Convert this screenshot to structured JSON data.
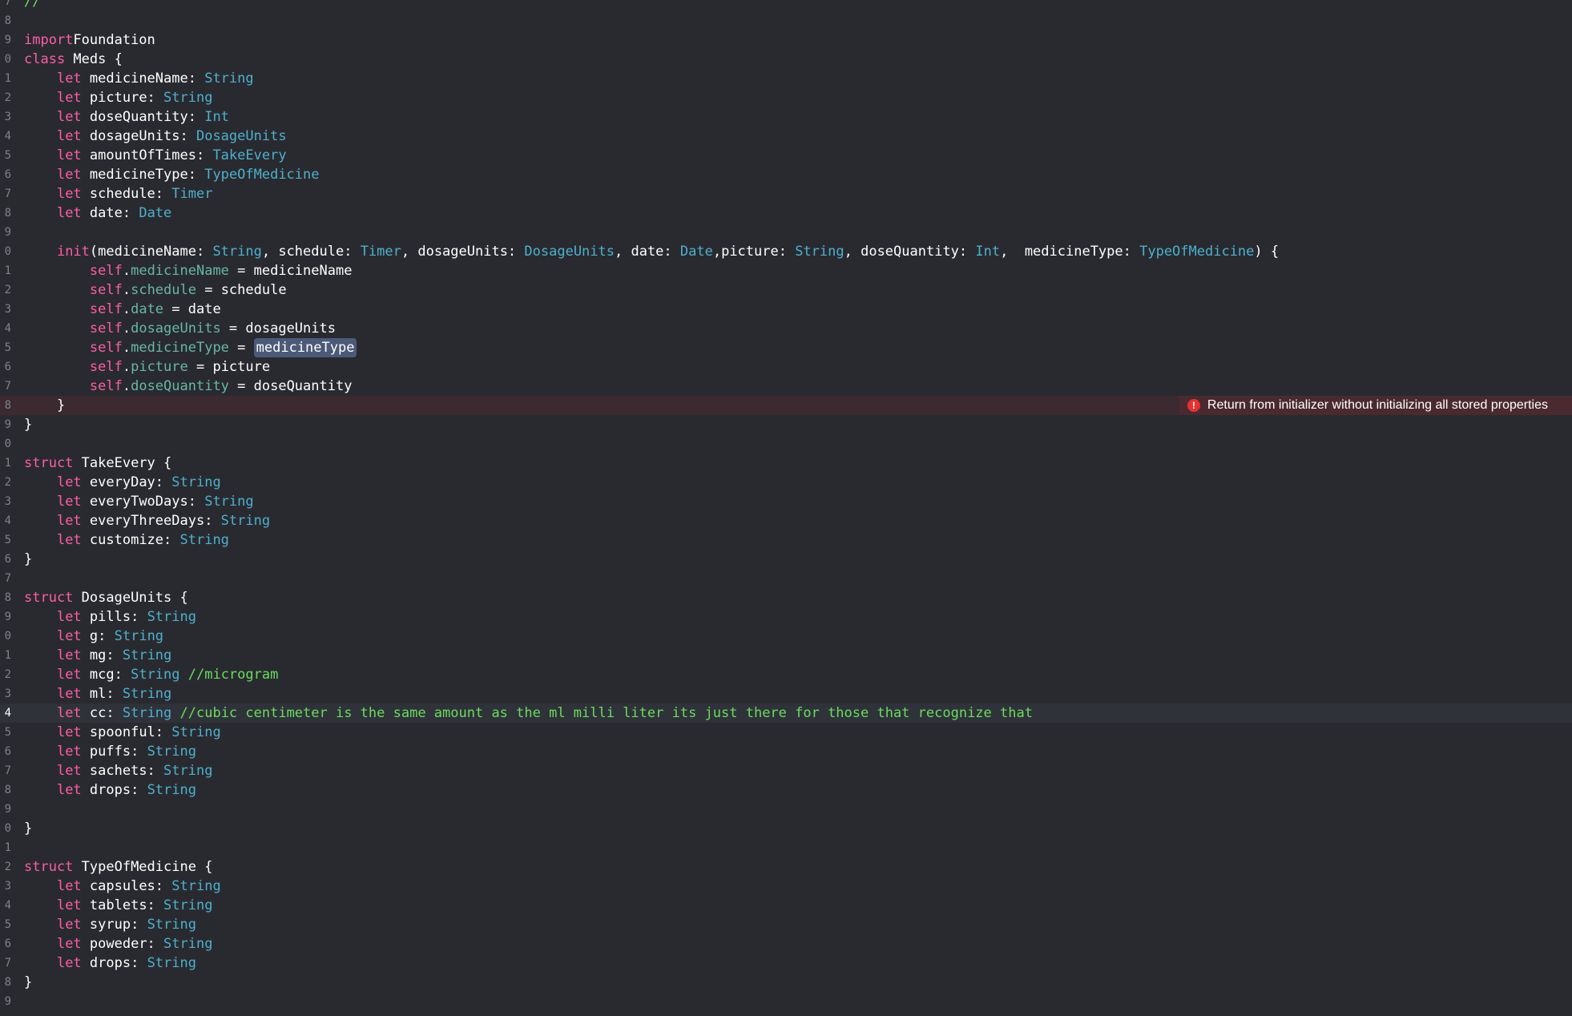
{
  "gutter": [
    "7",
    "8",
    "9",
    "0",
    "1",
    "2",
    "3",
    "4",
    "5",
    "6",
    "7",
    "8",
    "9",
    "0",
    "1",
    "2",
    "3",
    "4",
    "5",
    "6",
    "7",
    "8",
    "9",
    "0",
    "1",
    "2",
    "3",
    "4",
    "5",
    "6",
    "7",
    "8",
    "9",
    "0",
    "1",
    "2",
    "3",
    "4",
    "5",
    "6",
    "7",
    "8",
    "9",
    "0",
    "1",
    "2",
    "3",
    "4",
    "5",
    "6",
    "7",
    "8",
    "9"
  ],
  "lines": [
    [
      [
        "cmt2",
        "//"
      ]
    ],
    [],
    [
      [
        "kw",
        "import"
      ],
      [
        "",
        "Foundation"
      ]
    ],
    [
      [
        "kw",
        "class"
      ],
      [
        "",
        " Meds {"
      ]
    ],
    [
      [
        "",
        "    "
      ],
      [
        "kw",
        "let"
      ],
      [
        "",
        " medicineName: "
      ],
      [
        "typ2",
        "String"
      ]
    ],
    [
      [
        "",
        "    "
      ],
      [
        "kw",
        "let"
      ],
      [
        "",
        " picture: "
      ],
      [
        "typ2",
        "String"
      ]
    ],
    [
      [
        "",
        "    "
      ],
      [
        "kw",
        "let"
      ],
      [
        "",
        " doseQuantity: "
      ],
      [
        "typ2",
        "Int"
      ]
    ],
    [
      [
        "",
        "    "
      ],
      [
        "kw",
        "let"
      ],
      [
        "",
        " dosageUnits: "
      ],
      [
        "typ2",
        "DosageUnits"
      ]
    ],
    [
      [
        "",
        "    "
      ],
      [
        "kw",
        "let"
      ],
      [
        "",
        " amountOfTimes: "
      ],
      [
        "typ2",
        "TakeEvery"
      ]
    ],
    [
      [
        "",
        "    "
      ],
      [
        "kw",
        "let"
      ],
      [
        "",
        " medicineType: "
      ],
      [
        "typ2",
        "TypeOfMedicine"
      ]
    ],
    [
      [
        "",
        "    "
      ],
      [
        "kw",
        "let"
      ],
      [
        "",
        " schedule: "
      ],
      [
        "typ2",
        "Timer"
      ]
    ],
    [
      [
        "",
        "    "
      ],
      [
        "kw",
        "let"
      ],
      [
        "",
        " date: "
      ],
      [
        "typ2",
        "Date"
      ]
    ],
    [],
    [
      [
        "",
        "    "
      ],
      [
        "kw",
        "init"
      ],
      [
        "",
        "(medicineName: "
      ],
      [
        "typ2",
        "String"
      ],
      [
        "",
        ", schedule: "
      ],
      [
        "typ2",
        "Timer"
      ],
      [
        "",
        ", dosageUnits: "
      ],
      [
        "typ2",
        "DosageUnits"
      ],
      [
        "",
        ", date: "
      ],
      [
        "typ2",
        "Date"
      ],
      [
        "",
        ",picture: "
      ],
      [
        "typ2",
        "String"
      ],
      [
        "",
        ", doseQuantity: "
      ],
      [
        "typ2",
        "Int"
      ],
      [
        "",
        ",  medicineType: "
      ],
      [
        "typ2",
        "TypeOfMedicine"
      ],
      [
        "",
        ") {"
      ]
    ],
    [
      [
        "",
        "        "
      ],
      [
        "self",
        "self"
      ],
      [
        "",
        "."
      ],
      [
        "prop",
        "medicineName"
      ],
      [
        "",
        " = medicineName"
      ]
    ],
    [
      [
        "",
        "        "
      ],
      [
        "self",
        "self"
      ],
      [
        "",
        "."
      ],
      [
        "prop",
        "schedule"
      ],
      [
        "",
        " = schedule"
      ]
    ],
    [
      [
        "",
        "        "
      ],
      [
        "self",
        "self"
      ],
      [
        "",
        "."
      ],
      [
        "prop",
        "date"
      ],
      [
        "",
        " = date"
      ]
    ],
    [
      [
        "",
        "        "
      ],
      [
        "self",
        "self"
      ],
      [
        "",
        "."
      ],
      [
        "prop",
        "dosageUnits"
      ],
      [
        "",
        " = dosageUnits"
      ]
    ],
    [
      [
        "",
        "        "
      ],
      [
        "self",
        "self"
      ],
      [
        "",
        "."
      ],
      [
        "prop",
        "medicineType"
      ],
      [
        "",
        " = "
      ],
      [
        "hl",
        "medicineType"
      ]
    ],
    [
      [
        "",
        "        "
      ],
      [
        "self",
        "self"
      ],
      [
        "",
        "."
      ],
      [
        "prop",
        "picture"
      ],
      [
        "",
        " = picture"
      ]
    ],
    [
      [
        "",
        "        "
      ],
      [
        "self",
        "self"
      ],
      [
        "",
        "."
      ],
      [
        "prop",
        "doseQuantity"
      ],
      [
        "",
        " = doseQuantity"
      ]
    ],
    [
      [
        "",
        "    }"
      ]
    ],
    [
      [
        "",
        "}"
      ]
    ],
    [],
    [
      [
        "kw",
        "struct"
      ],
      [
        "",
        " TakeEvery {"
      ]
    ],
    [
      [
        "",
        "    "
      ],
      [
        "kw",
        "let"
      ],
      [
        "",
        " everyDay: "
      ],
      [
        "typ2",
        "String"
      ]
    ],
    [
      [
        "",
        "    "
      ],
      [
        "kw",
        "let"
      ],
      [
        "",
        " everyTwoDays: "
      ],
      [
        "typ2",
        "String"
      ]
    ],
    [
      [
        "",
        "    "
      ],
      [
        "kw",
        "let"
      ],
      [
        "",
        " everyThreeDays: "
      ],
      [
        "typ2",
        "String"
      ]
    ],
    [
      [
        "",
        "    "
      ],
      [
        "kw",
        "let"
      ],
      [
        "",
        " customize: "
      ],
      [
        "typ2",
        "String"
      ]
    ],
    [
      [
        "",
        "}"
      ]
    ],
    [],
    [
      [
        "kw",
        "struct"
      ],
      [
        "",
        " DosageUnits {"
      ]
    ],
    [
      [
        "",
        "    "
      ],
      [
        "kw",
        "let"
      ],
      [
        "",
        " pills: "
      ],
      [
        "typ2",
        "String"
      ]
    ],
    [
      [
        "",
        "    "
      ],
      [
        "kw",
        "let"
      ],
      [
        "",
        " g: "
      ],
      [
        "typ2",
        "String"
      ]
    ],
    [
      [
        "",
        "    "
      ],
      [
        "kw",
        "let"
      ],
      [
        "",
        " mg: "
      ],
      [
        "typ2",
        "String"
      ]
    ],
    [
      [
        "",
        "    "
      ],
      [
        "kw",
        "let"
      ],
      [
        "",
        " mcg: "
      ],
      [
        "typ2",
        "String"
      ],
      [
        "cmt2",
        " //microgram"
      ]
    ],
    [
      [
        "",
        "    "
      ],
      [
        "kw",
        "let"
      ],
      [
        "",
        " ml: "
      ],
      [
        "typ2",
        "String"
      ]
    ],
    [
      [
        "",
        "    "
      ],
      [
        "kw",
        "let"
      ],
      [
        "",
        " cc: "
      ],
      [
        "typ2",
        "String"
      ],
      [
        "cmt2",
        " //cubic centimeter is the same amount as the ml milli liter its just there for those that recognize that"
      ]
    ],
    [
      [
        "",
        "    "
      ],
      [
        "kw",
        "let"
      ],
      [
        "",
        " spoonful: "
      ],
      [
        "typ2",
        "String"
      ]
    ],
    [
      [
        "",
        "    "
      ],
      [
        "kw",
        "let"
      ],
      [
        "",
        " puffs: "
      ],
      [
        "typ2",
        "String"
      ]
    ],
    [
      [
        "",
        "    "
      ],
      [
        "kw",
        "let"
      ],
      [
        "",
        " sachets: "
      ],
      [
        "typ2",
        "String"
      ]
    ],
    [
      [
        "",
        "    "
      ],
      [
        "kw",
        "let"
      ],
      [
        "",
        " drops: "
      ],
      [
        "typ2",
        "String"
      ]
    ],
    [],
    [
      [
        "",
        "}"
      ]
    ],
    [],
    [
      [
        "kw",
        "struct"
      ],
      [
        "",
        " TypeOfMedicine {"
      ]
    ],
    [
      [
        "",
        "    "
      ],
      [
        "kw",
        "let"
      ],
      [
        "",
        " capsules: "
      ],
      [
        "typ2",
        "String"
      ]
    ],
    [
      [
        "",
        "    "
      ],
      [
        "kw",
        "let"
      ],
      [
        "",
        " tablets: "
      ],
      [
        "typ2",
        "String"
      ]
    ],
    [
      [
        "",
        "    "
      ],
      [
        "kw",
        "let"
      ],
      [
        "",
        " syrup: "
      ],
      [
        "typ2",
        "String"
      ]
    ],
    [
      [
        "",
        "    "
      ],
      [
        "kw",
        "let"
      ],
      [
        "",
        " poweder: "
      ],
      [
        "typ2",
        "String"
      ]
    ],
    [
      [
        "",
        "    "
      ],
      [
        "kw",
        "let"
      ],
      [
        "",
        " drops: "
      ],
      [
        "typ2",
        "String"
      ]
    ],
    [
      [
        "",
        "}"
      ]
    ],
    []
  ],
  "error_line_index": 21,
  "current_line_index": 37,
  "error": {
    "icon": "error-circle-icon",
    "icon_glyph": "!",
    "message": "Return from initializer without initializing all stored properties"
  },
  "colors": {
    "background": "#292a30",
    "keyword": "#fc5fa3",
    "type": "#4eb0cc",
    "property": "#67b7a4",
    "comment": "#6bdc5e",
    "error_line": "#3b2a30",
    "error_icon": "#e5322e"
  }
}
